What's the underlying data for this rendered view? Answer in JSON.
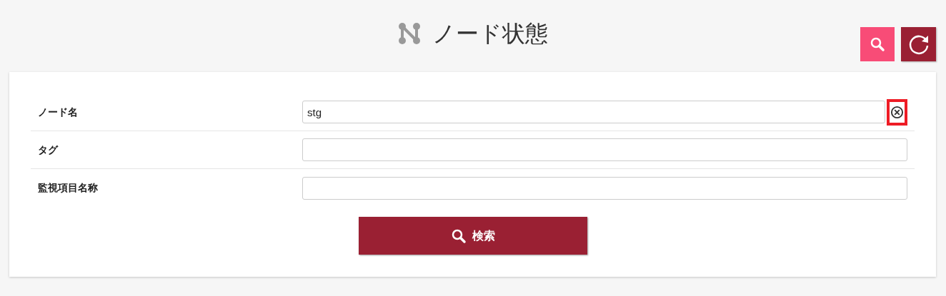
{
  "header": {
    "title": "ノード状態"
  },
  "fields": [
    {
      "label": "ノード名",
      "value": "stg",
      "clear_button": {
        "highlighted": true
      }
    },
    {
      "label": "タグ"
    },
    {
      "label": "監視項目名称"
    }
  ],
  "search_button": {
    "label": "検索"
  }
}
